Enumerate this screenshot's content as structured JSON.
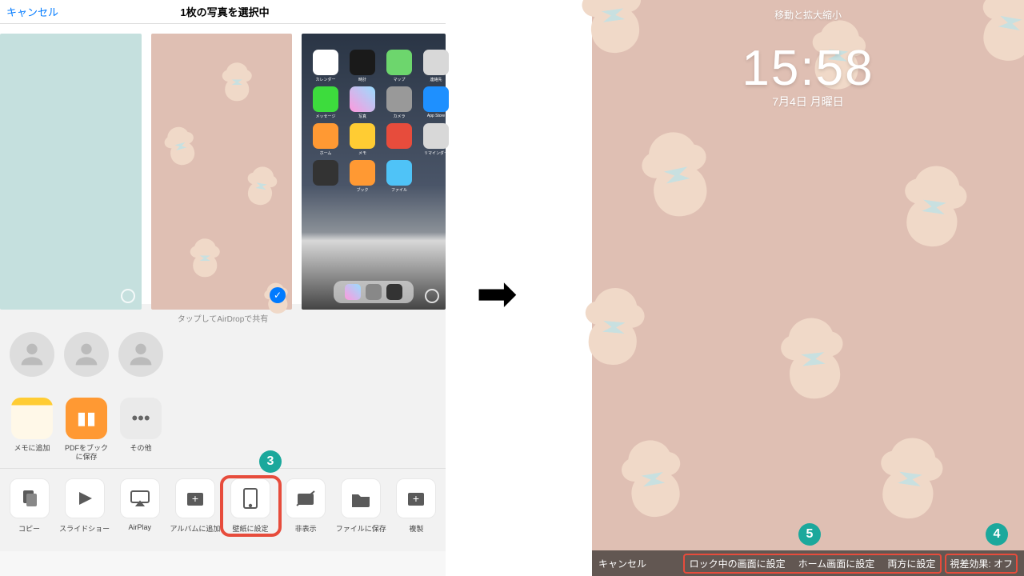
{
  "left": {
    "cancel": "キャンセル",
    "title": "1枚の写真を選択中",
    "airdrop": "タップしてAirDropで共有",
    "apps": [
      {
        "n": "メモに追加"
      },
      {
        "n": "PDFをブックに保存"
      },
      {
        "n": "その他"
      }
    ],
    "actions": [
      "コピー",
      "スライドショー",
      "AirPlay",
      "アルバムに追加",
      "壁紙に設定",
      "非表示",
      "ファイルに保存",
      "複製"
    ],
    "icons": [
      "カレンダー",
      "時計",
      "マップ",
      "連絡先",
      "メッセージ",
      "写真",
      "カメラ",
      "App Store",
      "ホーム",
      "メモ",
      "",
      "リマインダー",
      "",
      "ブック",
      "ファイル"
    ]
  },
  "right": {
    "top": "移動と拡大縮小",
    "time": "15:58",
    "date": "7月4日 月曜日",
    "cancel": "キャンセル",
    "opts": [
      "ロック中の画面に設定",
      "ホーム画面に設定",
      "両方に設定"
    ],
    "parallax": "視差効果: オフ"
  },
  "badges": {
    "b3": "3",
    "b4": "4",
    "b5": "5"
  }
}
